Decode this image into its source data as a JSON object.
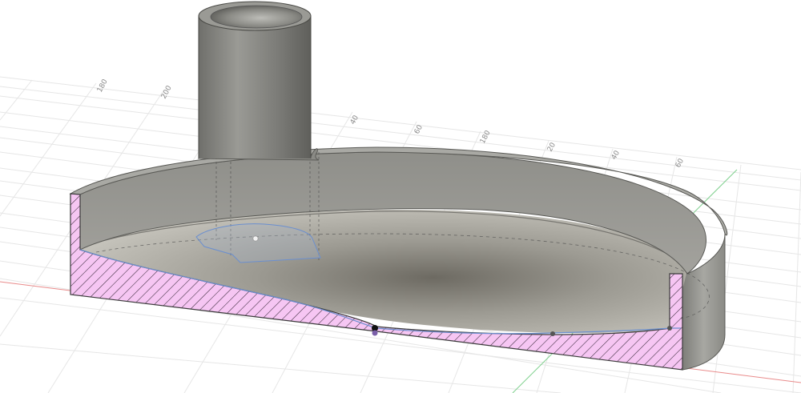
{
  "viewport": {
    "background": "#ffffff",
    "grid_color": "#e4e4e4",
    "x_axis_color": "#e05a5a",
    "y_axis_color": "#3cba54"
  },
  "grid_labels": [
    "180",
    "200",
    "40",
    "60",
    "180",
    "20",
    "40",
    "60"
  ],
  "model": {
    "body_color": "#8d8d88",
    "section_hatch_color": "#f3bef1",
    "sketch_profile_color": "#5b86c9"
  }
}
